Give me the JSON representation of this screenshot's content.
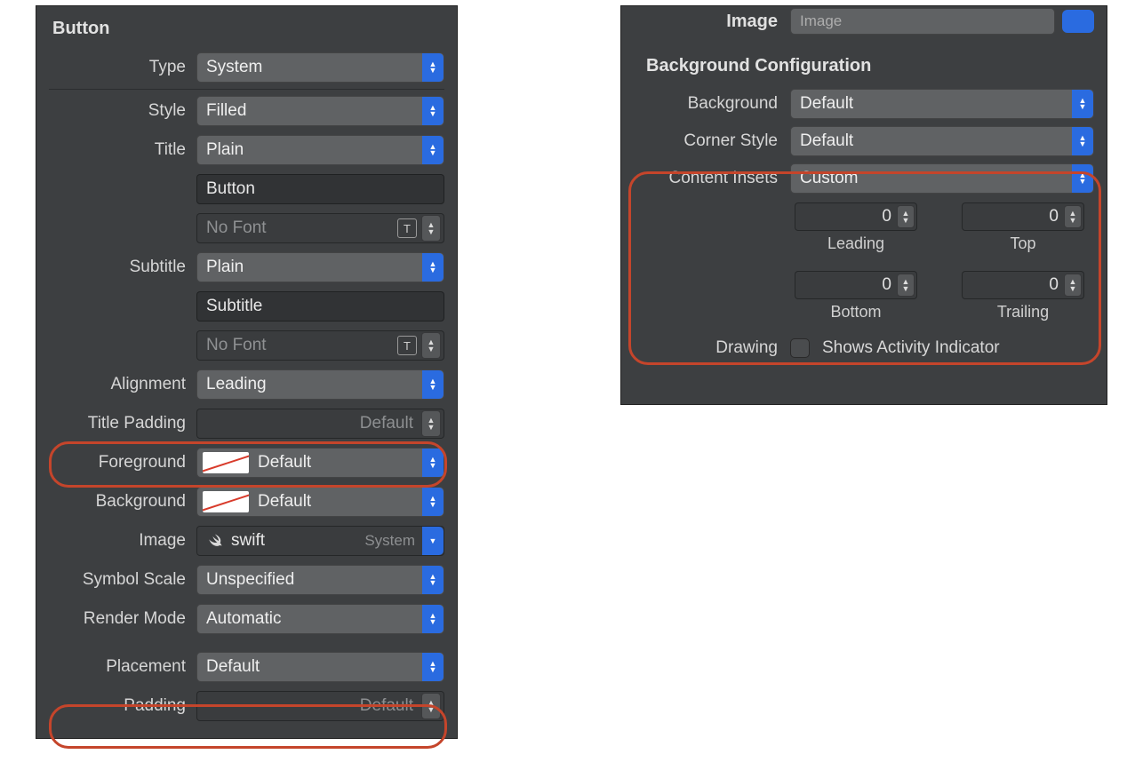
{
  "left": {
    "section": "Button",
    "type": {
      "label": "Type",
      "value": "System"
    },
    "style": {
      "label": "Style",
      "value": "Filled"
    },
    "title": {
      "label": "Title",
      "mode": "Plain",
      "text": "Button",
      "font_placeholder": "No Font"
    },
    "subtitle": {
      "label": "Subtitle",
      "mode": "Plain",
      "text": "Subtitle",
      "font_placeholder": "No Font"
    },
    "alignment": {
      "label": "Alignment",
      "value": "Leading"
    },
    "title_padding": {
      "label": "Title Padding",
      "value": "Default"
    },
    "foreground": {
      "label": "Foreground",
      "value": "Default"
    },
    "background": {
      "label": "Background",
      "value": "Default"
    },
    "image": {
      "label": "Image",
      "value": "swift",
      "suffix": "System"
    },
    "symbol_scale": {
      "label": "Symbol Scale",
      "value": "Unspecified"
    },
    "render_mode": {
      "label": "Render Mode",
      "value": "Automatic"
    },
    "placement": {
      "label": "Placement",
      "value": "Default"
    },
    "padding": {
      "label": "Padding",
      "value": "Default"
    }
  },
  "right": {
    "image_row": {
      "label": "Image",
      "placeholder": "Image"
    },
    "section": "Background Configuration",
    "background": {
      "label": "Background",
      "value": "Default"
    },
    "corner_style": {
      "label": "Corner Style",
      "value": "Default"
    },
    "content_insets": {
      "label": "Content Insets",
      "value": "Custom",
      "leading": {
        "value": "0",
        "label": "Leading"
      },
      "top": {
        "value": "0",
        "label": "Top"
      },
      "bottom": {
        "value": "0",
        "label": "Bottom"
      },
      "trailing": {
        "value": "0",
        "label": "Trailing"
      }
    },
    "drawing": {
      "label": "Drawing",
      "checkbox_label": "Shows Activity Indicator"
    }
  }
}
